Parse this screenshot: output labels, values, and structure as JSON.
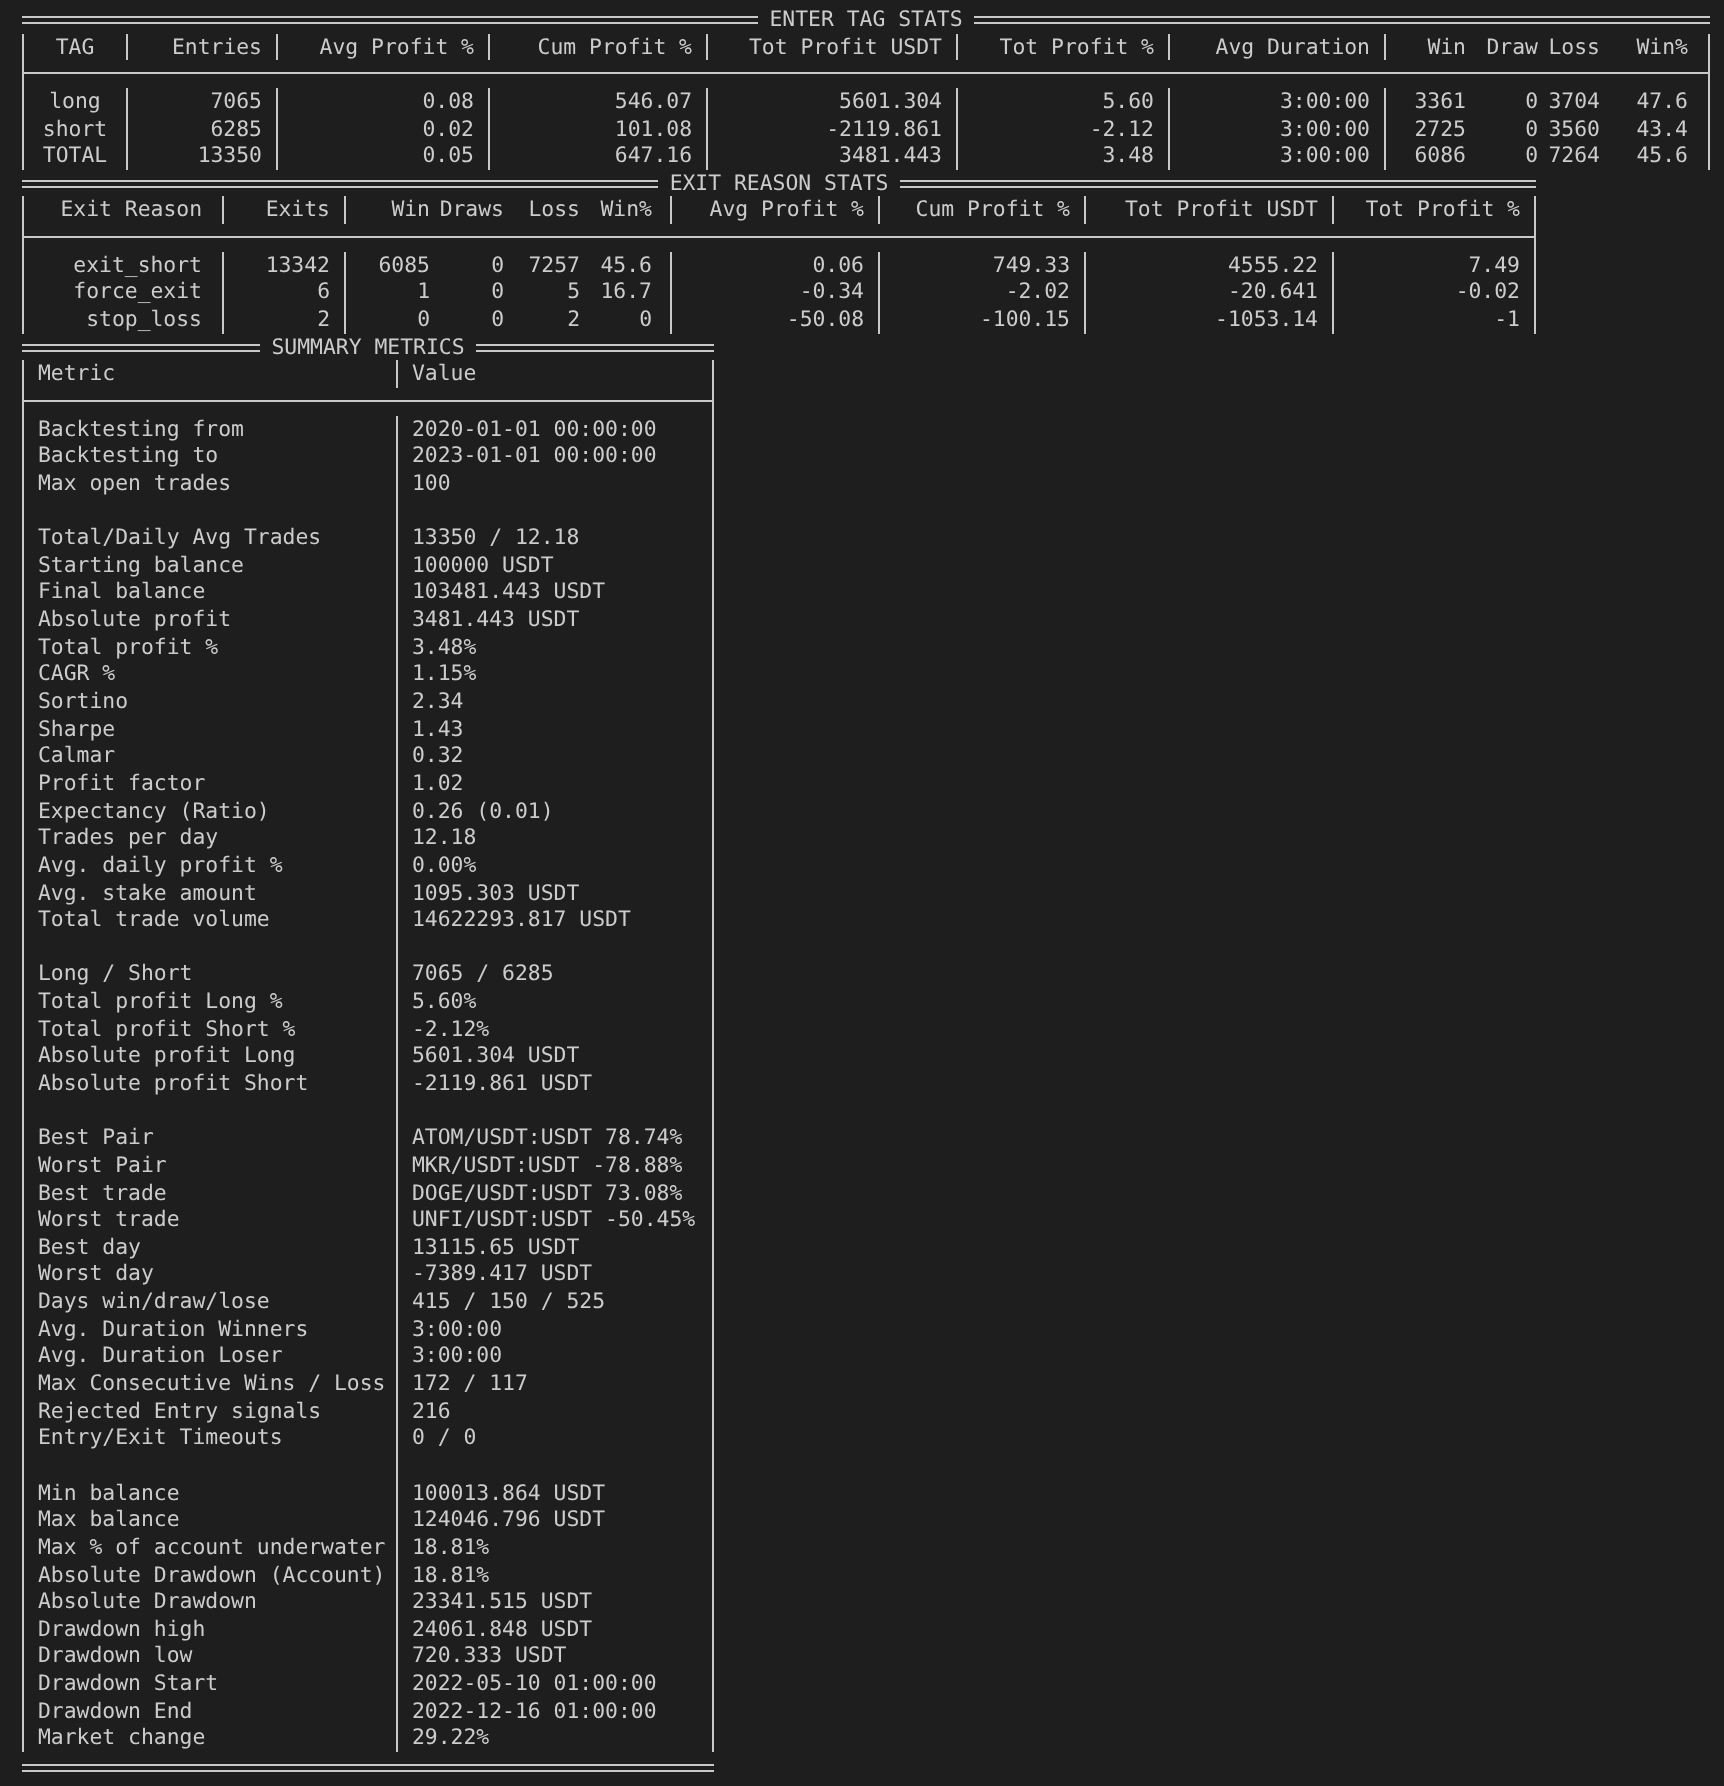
{
  "enter_tag_stats": {
    "title": "ENTER TAG STATS",
    "columns": [
      "TAG",
      "Entries",
      "Avg Profit %",
      "Cum Profit %",
      "Tot Profit USDT",
      "Tot Profit %",
      "Avg Duration",
      "Win",
      "Draw",
      "Loss",
      "Win%"
    ],
    "rows": [
      [
        "long",
        "7065",
        "0.08",
        "546.07",
        "5601.304",
        "5.60",
        "3:00:00",
        "3361",
        "0",
        "3704",
        "47.6"
      ],
      [
        "short",
        "6285",
        "0.02",
        "101.08",
        "-2119.861",
        "-2.12",
        "3:00:00",
        "2725",
        "0",
        "3560",
        "43.4"
      ],
      [
        "TOTAL",
        "13350",
        "0.05",
        "647.16",
        "3481.443",
        "3.48",
        "3:00:00",
        "6086",
        "0",
        "7264",
        "45.6"
      ]
    ]
  },
  "exit_reason_stats": {
    "title": "EXIT REASON STATS",
    "columns": [
      "Exit Reason",
      "Exits",
      "Win",
      "Draws",
      "Loss",
      "Win%",
      "Avg Profit %",
      "Cum Profit %",
      "Tot Profit USDT",
      "Tot Profit %"
    ],
    "rows": [
      [
        "exit_short",
        "13342",
        "6085",
        "0",
        "7257",
        "45.6",
        "0.06",
        "749.33",
        "4555.22",
        "7.49"
      ],
      [
        "force_exit",
        "6",
        "1",
        "0",
        "5",
        "16.7",
        "-0.34",
        "-2.02",
        "-20.641",
        "-0.02"
      ],
      [
        "stop_loss",
        "2",
        "0",
        "0",
        "2",
        "0",
        "-50.08",
        "-100.15",
        "-1053.14",
        "-1"
      ]
    ]
  },
  "summary_metrics": {
    "title": "SUMMARY METRICS",
    "columns": [
      "Metric",
      "Value"
    ],
    "groups": [
      [
        {
          "metric": "Backtesting from",
          "value": "2020-01-01 00:00:00"
        },
        {
          "metric": "Backtesting to",
          "value": "2023-01-01 00:00:00"
        },
        {
          "metric": "Max open trades",
          "value": "100"
        }
      ],
      [
        {
          "metric": "Total/Daily Avg Trades",
          "value": "13350 / 12.18"
        },
        {
          "metric": "Starting balance",
          "value": "100000 USDT"
        },
        {
          "metric": "Final balance",
          "value": "103481.443 USDT"
        },
        {
          "metric": "Absolute profit",
          "value": "3481.443 USDT"
        },
        {
          "metric": "Total profit %",
          "value": "3.48%"
        },
        {
          "metric": "CAGR %",
          "value": "1.15%"
        },
        {
          "metric": "Sortino",
          "value": "2.34"
        },
        {
          "metric": "Sharpe",
          "value": "1.43"
        },
        {
          "metric": "Calmar",
          "value": "0.32"
        },
        {
          "metric": "Profit factor",
          "value": "1.02"
        },
        {
          "metric": "Expectancy (Ratio)",
          "value": "0.26 (0.01)"
        },
        {
          "metric": "Trades per day",
          "value": "12.18"
        },
        {
          "metric": "Avg. daily profit %",
          "value": "0.00%"
        },
        {
          "metric": "Avg. stake amount",
          "value": "1095.303 USDT"
        },
        {
          "metric": "Total trade volume",
          "value": "14622293.817 USDT"
        }
      ],
      [
        {
          "metric": "Long / Short",
          "value": "7065 / 6285"
        },
        {
          "metric": "Total profit Long %",
          "value": "5.60%"
        },
        {
          "metric": "Total profit Short %",
          "value": "-2.12%"
        },
        {
          "metric": "Absolute profit Long",
          "value": "5601.304 USDT"
        },
        {
          "metric": "Absolute profit Short",
          "value": "-2119.861 USDT"
        }
      ],
      [
        {
          "metric": "Best Pair",
          "value": "ATOM/USDT:USDT 78.74%"
        },
        {
          "metric": "Worst Pair",
          "value": "MKR/USDT:USDT -78.88%"
        },
        {
          "metric": "Best trade",
          "value": "DOGE/USDT:USDT 73.08%"
        },
        {
          "metric": "Worst trade",
          "value": "UNFI/USDT:USDT -50.45%"
        },
        {
          "metric": "Best day",
          "value": "13115.65 USDT"
        },
        {
          "metric": "Worst day",
          "value": "-7389.417 USDT"
        },
        {
          "metric": "Days win/draw/lose",
          "value": "415 / 150 / 525"
        },
        {
          "metric": "Avg. Duration Winners",
          "value": "3:00:00"
        },
        {
          "metric": "Avg. Duration Loser",
          "value": "3:00:00"
        },
        {
          "metric": "Max Consecutive Wins / Loss",
          "value": "172 / 117"
        },
        {
          "metric": "Rejected Entry signals",
          "value": "216"
        },
        {
          "metric": "Entry/Exit Timeouts",
          "value": "0 / 0"
        }
      ],
      [
        {
          "metric": "Min balance",
          "value": "100013.864 USDT"
        },
        {
          "metric": "Max balance",
          "value": "124046.796 USDT"
        },
        {
          "metric": "Max % of account underwater",
          "value": "18.81%"
        },
        {
          "metric": "Absolute Drawdown (Account)",
          "value": "18.81%"
        },
        {
          "metric": "Absolute Drawdown",
          "value": "23341.515 USDT"
        },
        {
          "metric": "Drawdown high",
          "value": "24061.848 USDT"
        },
        {
          "metric": "Drawdown low",
          "value": "720.333 USDT"
        },
        {
          "metric": "Drawdown Start",
          "value": "2022-05-10 01:00:00"
        },
        {
          "metric": "Drawdown End",
          "value": "2022-12-16 01:00:00"
        },
        {
          "metric": "Market change",
          "value": "29.22%"
        }
      ]
    ]
  }
}
